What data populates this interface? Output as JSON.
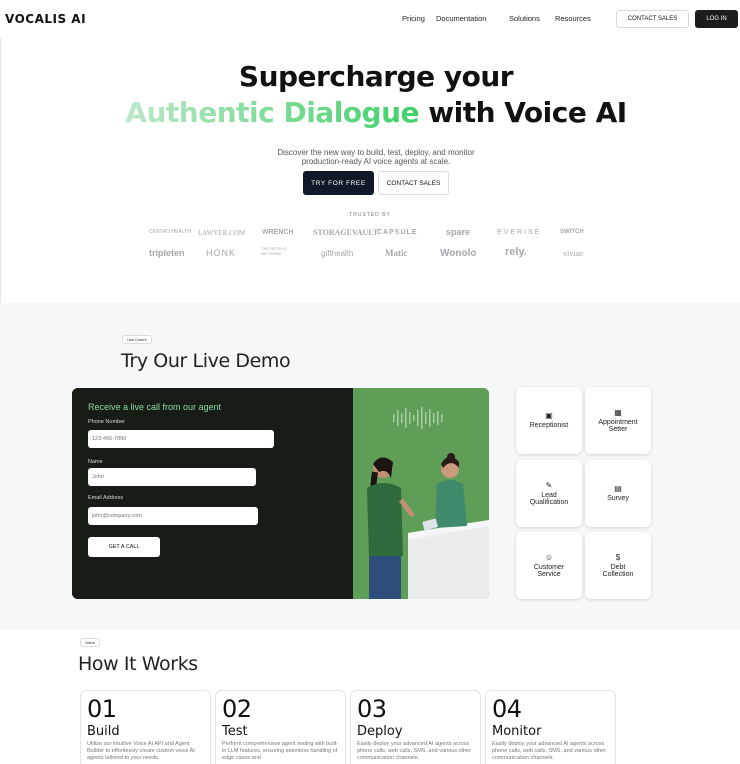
{
  "header": {
    "logo": "VOCALIS AI",
    "nav": [
      "Pricing",
      "Documentation",
      "Solutions",
      "Resources"
    ],
    "contact_label": "CONTACT SALES",
    "login_label": "LOG IN"
  },
  "hero": {
    "title_line1": "Supercharge your",
    "title_highlight": "Authentic Dialogue",
    "title_rest": "with Voice AI",
    "subtitle_line1": "Discover the new way to build, test, deploy, and monitor",
    "subtitle_line2": "production-ready AI voice agents at scale.",
    "try_label": "TRY FOR FREE",
    "contact_label": "CONTACT SALES",
    "trusted_label": "TRUSTED BY"
  },
  "brands": {
    "row1": [
      "CENTRO HEALTH",
      "LAWYER.COM",
      "WRENCH",
      "STORAGEVAULT",
      "CAPSULE",
      "spare",
      "EVERISE",
      "SWITCH"
    ],
    "row2": [
      "tripleten",
      "HONK",
      "THE HOTELS NETWORK",
      "gifthealth",
      "Matic",
      "Wonolo",
      "rely.",
      "vivian"
    ]
  },
  "demo": {
    "badge": "Use Cases",
    "title": "Try Our Live Demo",
    "form_title": "Receive a live call from our agent",
    "phone_label": "Phone Number",
    "phone_placeholder": "123-456-7890",
    "name_label": "Name",
    "name_placeholder": "John",
    "email_label": "Email Address",
    "email_placeholder": "john@company.com",
    "call_label": "GET A CALL",
    "use_cases": [
      {
        "line1": "Receptionist",
        "line2": "",
        "icon": "receptionist-icon"
      },
      {
        "line1": "Appointment",
        "line2": "Setter",
        "icon": "calendar-icon"
      },
      {
        "line1": "Lead",
        "line2": "Qualification",
        "icon": "lead-icon"
      },
      {
        "line1": "Survey",
        "line2": "",
        "icon": "survey-icon"
      },
      {
        "line1": "Customer",
        "line2": "Service",
        "icon": "smile-icon"
      },
      {
        "line1": "Debt",
        "line2": "Collection",
        "icon": "dollar-icon"
      }
    ]
  },
  "how": {
    "badge": "Value",
    "title": "How It Works",
    "steps": [
      {
        "num": "01",
        "title": "Build",
        "desc": "Utilize our intuitive Voice AI API and Agent Builder to effortlessly create custom voice AI agents tailored to your needs."
      },
      {
        "num": "02",
        "title": "Test",
        "desc": "Perform comprehensive agent testing with built-in LLM features, ensuring seamless handling of edge cases and"
      },
      {
        "num": "03",
        "title": "Deploy",
        "desc": "Easily deploy your advanced AI agents across phone calls, web calls, SMS, and various other communication channels."
      },
      {
        "num": "04",
        "title": "Monitor",
        "desc": "Easily deploy your advanced AI agents across phone calls, web calls, SMS, and various other communication channels."
      }
    ]
  }
}
